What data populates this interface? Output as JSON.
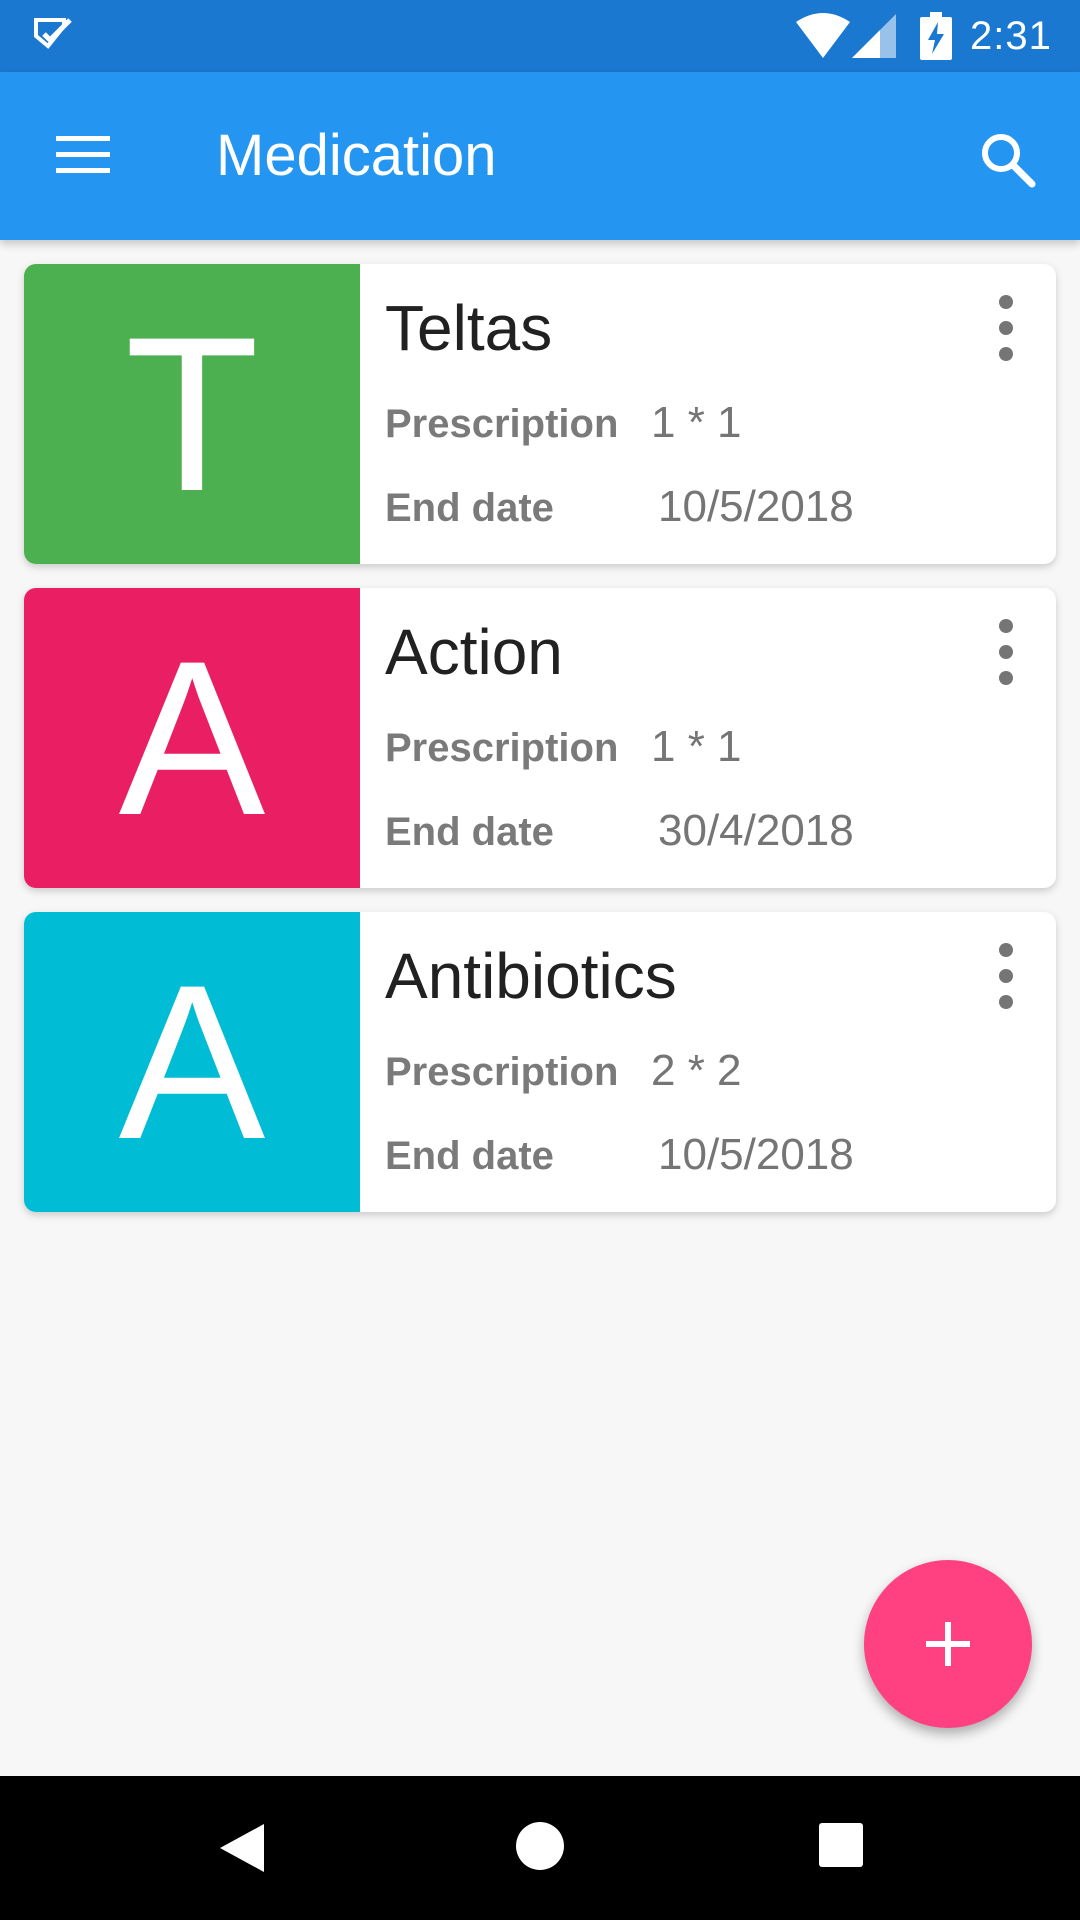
{
  "status_bar": {
    "time": "2:31",
    "icons": [
      "notification-check-icon",
      "wifi-icon",
      "cell-signal-icon",
      "battery-charging-icon"
    ]
  },
  "app_bar": {
    "title": "Medication",
    "menu_icon": "hamburger-menu-icon",
    "search_icon": "search-icon",
    "color": "#2496f2"
  },
  "medications": [
    {
      "letter": "T",
      "name": "Teltas",
      "prescription_label": "Prescription",
      "prescription": "1 * 1",
      "end_date_label": "End date",
      "end_date": "10/5/2018",
      "color": "#4caf50"
    },
    {
      "letter": "A",
      "name": "Action",
      "prescription_label": "Prescription",
      "prescription": "1 * 1",
      "end_date_label": "End date",
      "end_date": "30/4/2018",
      "color": "#e91e63"
    },
    {
      "letter": "A",
      "name": "Antibiotics",
      "prescription_label": "Prescription",
      "prescription": "2 * 2",
      "end_date_label": "End date",
      "end_date": "10/5/2018",
      "color": "#00bcd4"
    }
  ],
  "fab": {
    "icon": "plus-icon",
    "color": "#ff4081"
  },
  "nav_bar": {
    "icons": [
      "back-icon",
      "home-icon",
      "recents-icon"
    ]
  }
}
